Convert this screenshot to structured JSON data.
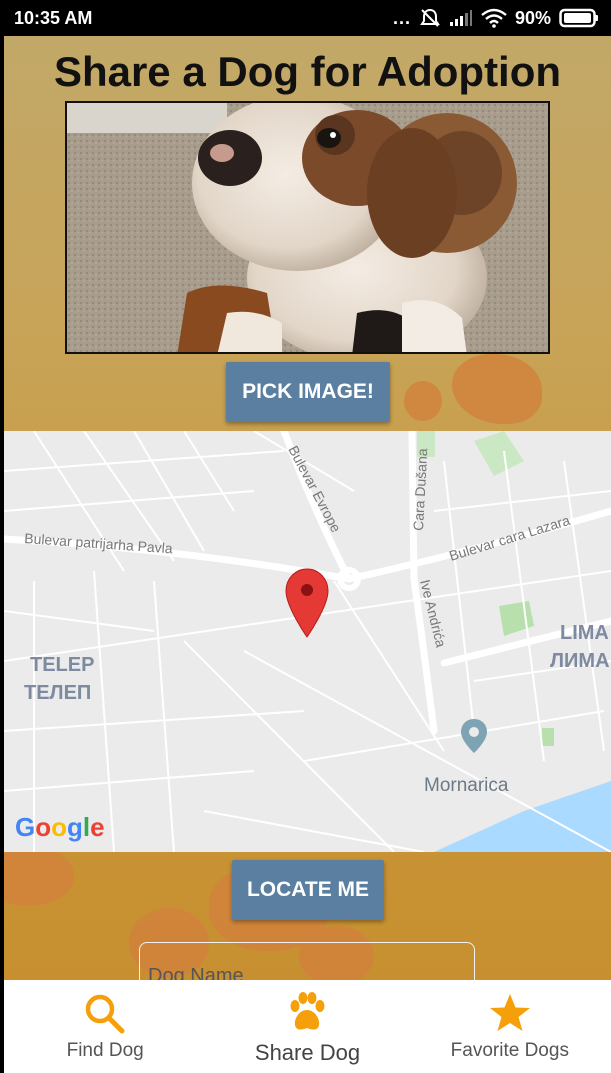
{
  "status_bar": {
    "time": "10:35 AM",
    "dots": "...",
    "battery_percent": "90%"
  },
  "page": {
    "title": "Share a Dog for Adoption"
  },
  "buttons": {
    "pick_image": "PICK IMAGE!",
    "locate_me": "LOCATE ME"
  },
  "map": {
    "streets": {
      "bulevar_evrope": "Bulevar Evrope",
      "cara_dusana": "Cara Dušana",
      "bulevar_cara_lazara": "Bulevar cara Lazara",
      "bulevar_patrijarha_pavla": "Bulevar patrijarha Pavla",
      "ive_andrica": "Ive Andrića"
    },
    "areas": {
      "telep_latin": "TELEP",
      "telep_cyrillic": "ТЕЛЕП",
      "lima_latin": "LIMA",
      "lima_cyrillic": "ЛИМА",
      "mornarica": "Mornarica"
    },
    "attribution": "Google"
  },
  "form": {
    "dog_name_placeholder": "Dog Name"
  },
  "bottom_nav": {
    "items": [
      {
        "label": "Find Dog",
        "icon": "search-icon"
      },
      {
        "label": "Share Dog",
        "icon": "paw-icon"
      },
      {
        "label": "Favorite Dogs",
        "icon": "star-icon"
      }
    ],
    "active_index": 1,
    "accent": "#f59f0a"
  },
  "colors": {
    "button": "#5a7fa0",
    "map_pin": "#e53935",
    "accent": "#f59f0a"
  }
}
